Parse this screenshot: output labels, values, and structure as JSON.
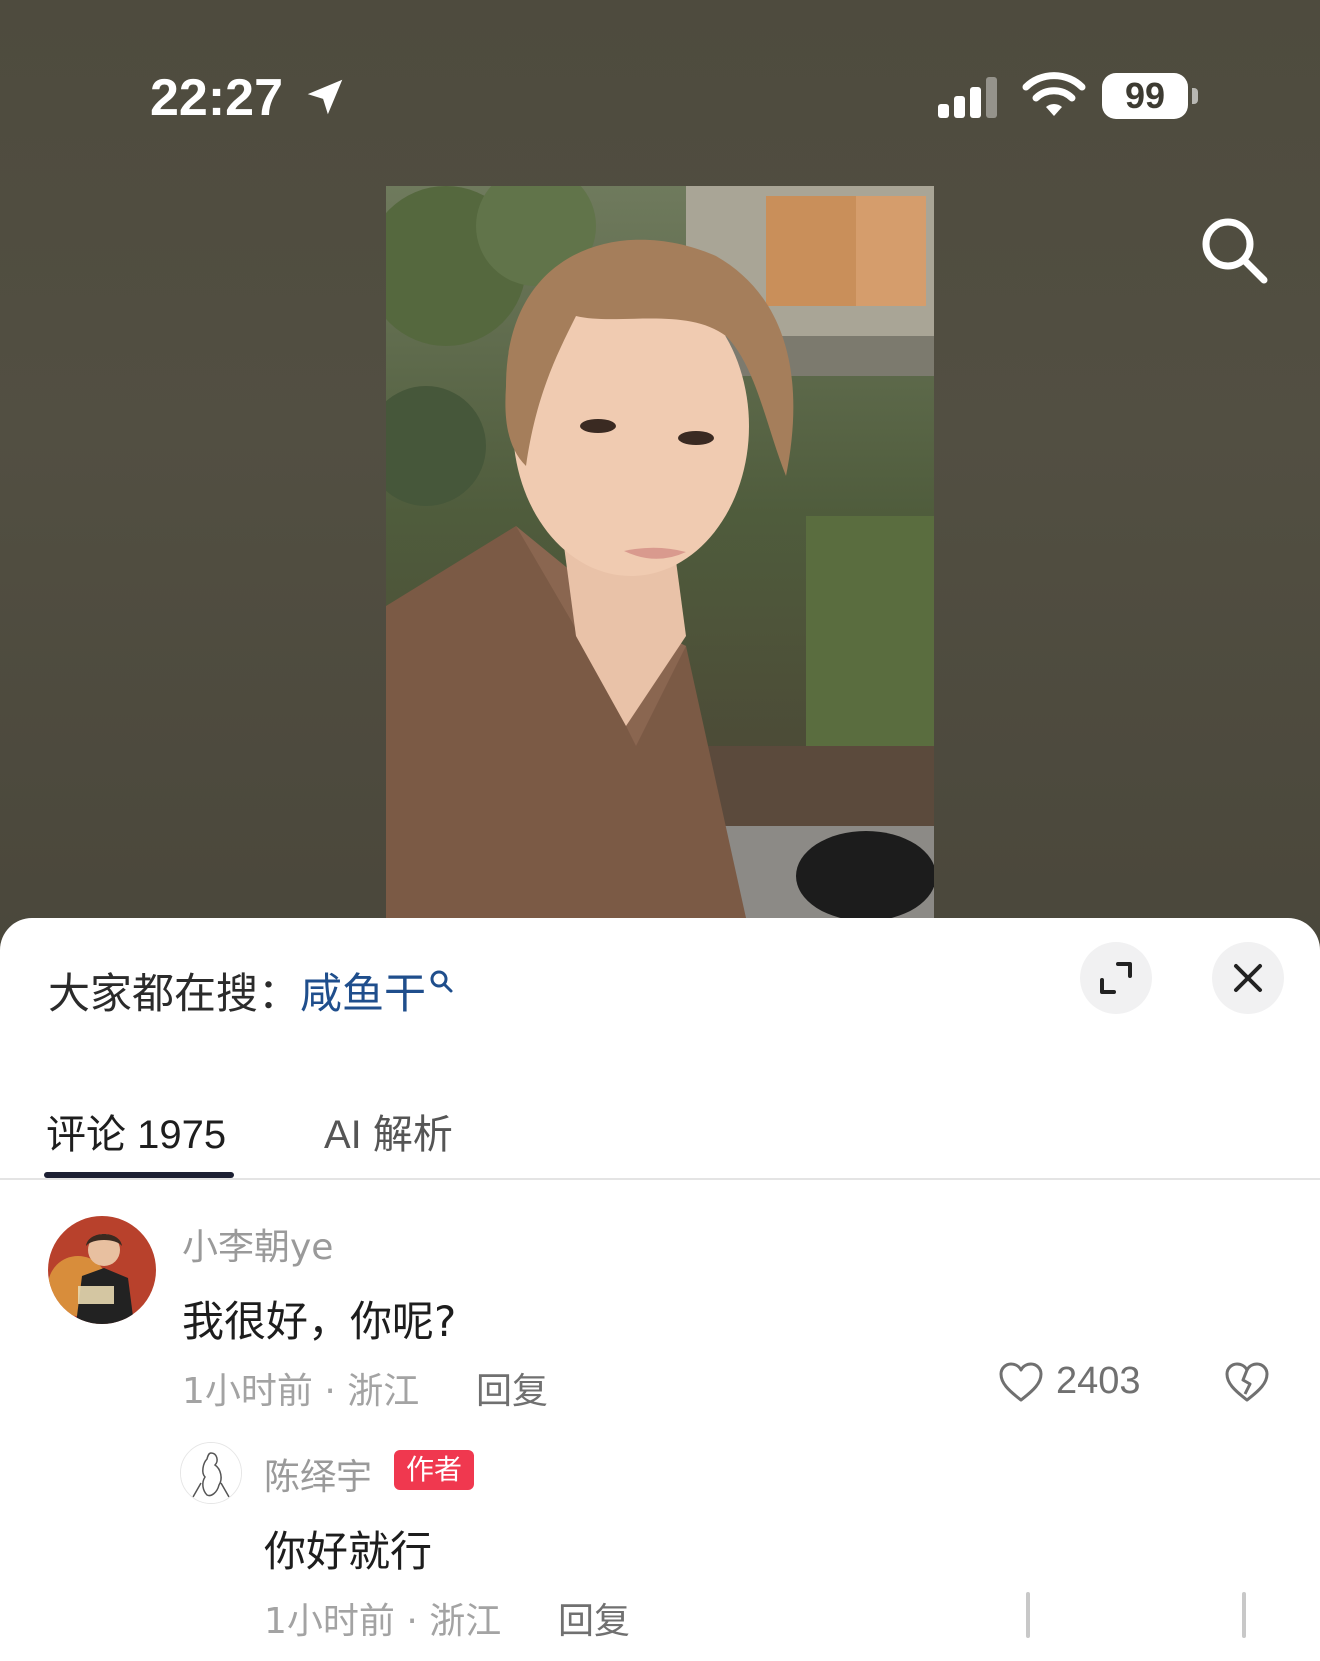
{
  "status_bar": {
    "time": "22:27",
    "battery": "99"
  },
  "search_suggest": {
    "prefix": "大家都在搜：",
    "keyword": "咸鱼干"
  },
  "tabs": [
    {
      "label": "评论 1975",
      "active": true
    },
    {
      "label": "AI 解析",
      "active": false
    }
  ],
  "comment": {
    "user": "小李朝ye",
    "text": "我很好，你呢?",
    "meta": "1小时前 · 浙江",
    "reply_label": "回复",
    "likes": "2403"
  },
  "reply": {
    "user": "陈绎宇",
    "badge": "作者",
    "text": "你好就行",
    "meta": "1小时前 · 浙江",
    "reply_label": "回复"
  },
  "colors": {
    "top_background": "#4e4b3e",
    "keyword": "#1f4e8c",
    "author_badge": "#f0384f",
    "tab_underline": "#1c2033"
  }
}
